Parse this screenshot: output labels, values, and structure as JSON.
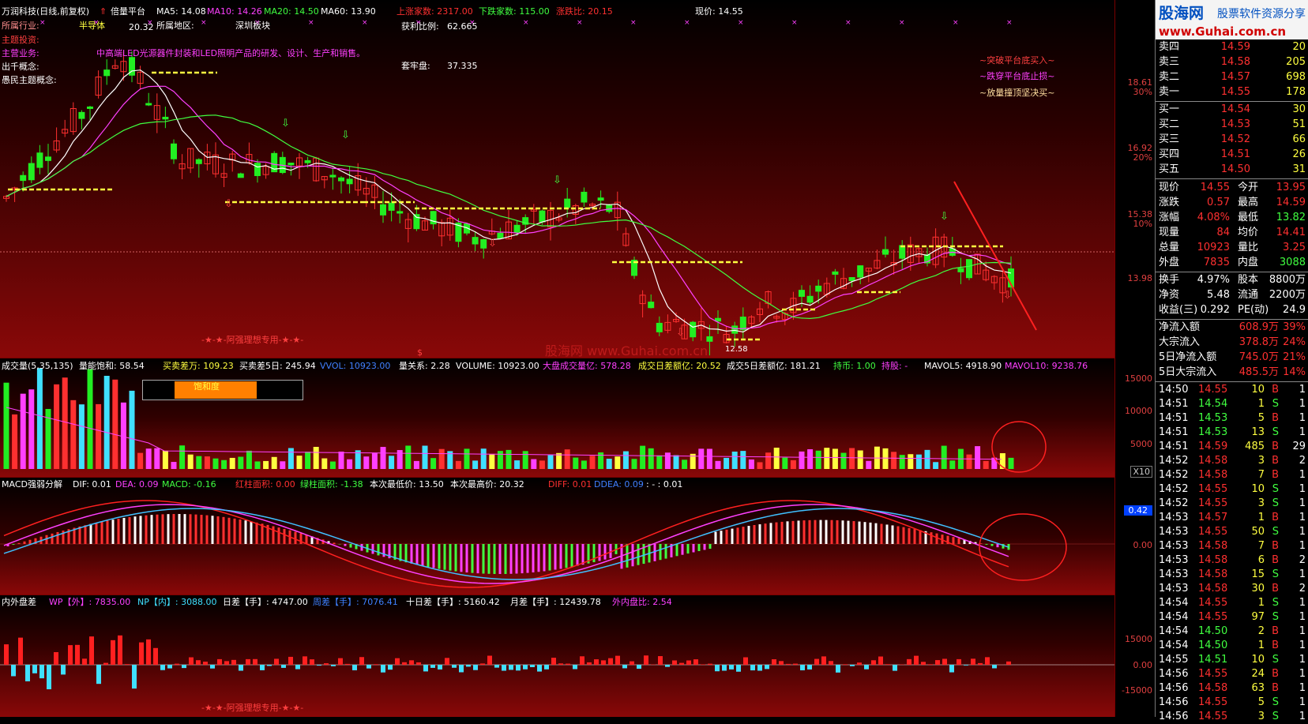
{
  "colors": {
    "up": "#ff3030",
    "down": "#22ee22",
    "yellow": "#ffff40",
    "magenta": "#ff40ff",
    "cyan": "#40e0ff",
    "bg_top": "#000000",
    "bg_bottom": "#8a0808",
    "accent": "#ffd000"
  },
  "header": {
    "title": "万润科技(日线,前复权)",
    "arrow": "⇑",
    "strategy": "倍量平台",
    "ma5": "MA5: 14.08",
    "ma10": "MA10: 14.26",
    "ma20": "MA20: 14.50",
    "ma60": "MA60: 13.90",
    "up_count": "上涨家数: 2317.00",
    "down_count": "下跌家数: 115.00",
    "up_ratio": "涨跌比: 20.15",
    "price": "现价: 14.55"
  },
  "info": {
    "industry_label": "所属行业:",
    "industry": "半导体",
    "region_label": "所属地区:",
    "region": "深圳板块",
    "theme_label": "主题投资:",
    "business_label": "主营业务:",
    "business": "中高端LED光源器件封装和LED照明产品的研发、设计、生产和销售。",
    "concept_label": "出千概念:",
    "pop_label": "愚民主题概念:",
    "profit_label": "获利比例:",
    "profit": "62.665",
    "trap_label": "套牢盘:",
    "trap": "37.335",
    "high_marker": "20.32",
    "low_marker": "12.58",
    "signal1": "~突破平台底买入~",
    "signal2": "~跌穿平台底止损~",
    "signal3": "~放量撞顶坚决买~",
    "watermark": "-★-★-阿强理想专用-★-★-",
    "site": "股海网 www.Guhai.com.cn",
    "dollar": "$"
  },
  "main_axis": [
    {
      "price": "18.61",
      "pct": "30%"
    },
    {
      "price": "16.92",
      "pct": "20%"
    },
    {
      "price": "15.38",
      "pct": "10%"
    },
    {
      "price": "13.98",
      "pct": ""
    }
  ],
  "volume": {
    "title": "成交量(5,35,135)",
    "sat": "量能饱和: 58.54",
    "buy_diff": "买卖差万: 109.23",
    "buy_diff5": "买卖差5日: 245.94",
    "vvol": "VVOL: 10923.00",
    "rel": "量关系: 2.28",
    "vol": "VOLUME: 10923.00",
    "big": "大盘成交量亿: 578.28",
    "day_diff": "成交日差额亿: 20.52",
    "day5": "成交5日差额亿: 181.21",
    "hold": "持币: 1.00",
    "hold2": "持股: -",
    "mavol5": "MAVOL5: 4918.90",
    "mavol10": "MAVOL10: 9238.76",
    "sat_box": "饱和度",
    "sat_fraction": 0.65,
    "axis": [
      "15000",
      "10000",
      "5000",
      "X10"
    ]
  },
  "macd": {
    "title": "MACD强弱分解",
    "dif": "DIF: 0.01",
    "dea": "DEA: 0.09",
    "macd": "MACD: -0.16",
    "red_area": "红柱面积: 0.00",
    "green_area": "绿柱面积: -1.38",
    "low_price": "本次最低价: 13.50",
    "high_price": "本次最高价: 20.32",
    "diff": "DIFF: 0.01",
    "ddea": "DDEA: 0.09",
    "extra": ": - : 0.01",
    "axis": [
      "0.42",
      "0.00"
    ]
  },
  "io": {
    "title": "内外盘差",
    "wp": "WP【外】: 7835.00",
    "np": "NP【内】: 3088.00",
    "day_diff": "日差【手】: 4747.00",
    "week_diff": "周差【手】: 7076.41",
    "ten_diff": "十日差【手】: 5160.42",
    "month_diff": "月差【手】: 12439.78",
    "ratio": "外内盘比: 2.54",
    "axis": [
      "15000",
      "0.00",
      "-15000"
    ]
  },
  "logo": {
    "name": "股海网",
    "tag": "股票软件资源分享",
    "url": "www.Guhai.com.cn"
  },
  "order_book": [
    {
      "label": "卖四",
      "price": "14.59",
      "vol": "20"
    },
    {
      "label": "卖三",
      "price": "14.58",
      "vol": "205"
    },
    {
      "label": "卖二",
      "price": "14.57",
      "vol": "698"
    },
    {
      "label": "卖一",
      "price": "14.55",
      "vol": "178"
    },
    {
      "label": "买一",
      "price": "14.54",
      "vol": "30"
    },
    {
      "label": "买二",
      "price": "14.53",
      "vol": "51"
    },
    {
      "label": "买三",
      "price": "14.52",
      "vol": "66"
    },
    {
      "label": "买四",
      "price": "14.51",
      "vol": "26"
    },
    {
      "label": "买五",
      "price": "14.50",
      "vol": "31"
    }
  ],
  "quote": [
    {
      "l1": "现价",
      "v1": "14.55",
      "l2": "今开",
      "v2": "13.95"
    },
    {
      "l1": "涨跌",
      "v1": "0.57",
      "l2": "最高",
      "v2": "14.59"
    },
    {
      "l1": "涨幅",
      "v1": "4.08%",
      "l2": "最低",
      "v2": "13.82"
    },
    {
      "l1": "现量",
      "v1": "84",
      "l2": "均价",
      "v2": "14.41"
    },
    {
      "l1": "总量",
      "v1": "10923",
      "l2": "量比",
      "v2": "3.25"
    },
    {
      "l1": "外盘",
      "v1": "7835",
      "l2": "内盘",
      "v2": "3088"
    },
    {
      "l1": "换手",
      "v1": "4.97%",
      "l2": "股本",
      "v2": "8800万"
    },
    {
      "l1": "净资",
      "v1": "5.48",
      "l2": "流通",
      "v2": "2200万"
    },
    {
      "l1": "收益(三)",
      "v1": "0.292",
      "l2": "PE(动)",
      "v2": "24.9"
    }
  ],
  "flows": [
    {
      "label": "净流入额",
      "val": "608.9万",
      "pct": "39%"
    },
    {
      "label": "大宗流入",
      "val": "378.8万",
      "pct": "24%"
    },
    {
      "label": "5日净流入额",
      "val": "745.0万",
      "pct": "21%"
    },
    {
      "label": "5日大宗流入",
      "val": "485.5万",
      "pct": "14%"
    }
  ],
  "ticks": [
    {
      "t": "14:50",
      "p": "14.55",
      "v": "10",
      "bs": "B",
      "n": "1"
    },
    {
      "t": "14:51",
      "p": "14.54",
      "v": "1",
      "bs": "S",
      "n": "1"
    },
    {
      "t": "14:51",
      "p": "14.53",
      "v": "5",
      "bs": "B",
      "n": "1"
    },
    {
      "t": "14:51",
      "p": "14.53",
      "v": "13",
      "bs": "S",
      "n": "1"
    },
    {
      "t": "14:51",
      "p": "14.59",
      "v": "485",
      "bs": "B",
      "n": "29"
    },
    {
      "t": "14:52",
      "p": "14.58",
      "v": "3",
      "bs": "B",
      "n": "2"
    },
    {
      "t": "14:52",
      "p": "14.58",
      "v": "7",
      "bs": "B",
      "n": "1"
    },
    {
      "t": "14:52",
      "p": "14.55",
      "v": "10",
      "bs": "S",
      "n": "1"
    },
    {
      "t": "14:52",
      "p": "14.55",
      "v": "3",
      "bs": "S",
      "n": "1"
    },
    {
      "t": "14:53",
      "p": "14.57",
      "v": "1",
      "bs": "B",
      "n": "1"
    },
    {
      "t": "14:53",
      "p": "14.55",
      "v": "50",
      "bs": "S",
      "n": "1"
    },
    {
      "t": "14:53",
      "p": "14.58",
      "v": "7",
      "bs": "B",
      "n": "1"
    },
    {
      "t": "14:53",
      "p": "14.58",
      "v": "6",
      "bs": "B",
      "n": "2"
    },
    {
      "t": "14:53",
      "p": "14.58",
      "v": "15",
      "bs": "S",
      "n": "1"
    },
    {
      "t": "14:53",
      "p": "14.58",
      "v": "30",
      "bs": "B",
      "n": "2"
    },
    {
      "t": "14:54",
      "p": "14.55",
      "v": "1",
      "bs": "S",
      "n": "1"
    },
    {
      "t": "14:54",
      "p": "14.55",
      "v": "97",
      "bs": "S",
      "n": "1"
    },
    {
      "t": "14:54",
      "p": "14.50",
      "v": "2",
      "bs": "B",
      "n": "1"
    },
    {
      "t": "14:54",
      "p": "14.50",
      "v": "1",
      "bs": "B",
      "n": "1"
    },
    {
      "t": "14:55",
      "p": "14.51",
      "v": "10",
      "bs": "S",
      "n": "1"
    },
    {
      "t": "14:56",
      "p": "14.55",
      "v": "24",
      "bs": "B",
      "n": "1"
    },
    {
      "t": "14:56",
      "p": "14.58",
      "v": "63",
      "bs": "B",
      "n": "1"
    },
    {
      "t": "14:56",
      "p": "14.55",
      "v": "5",
      "bs": "S",
      "n": "1"
    },
    {
      "t": "14:56",
      "p": "14.55",
      "v": "3",
      "bs": "S",
      "n": "1"
    }
  ]
}
